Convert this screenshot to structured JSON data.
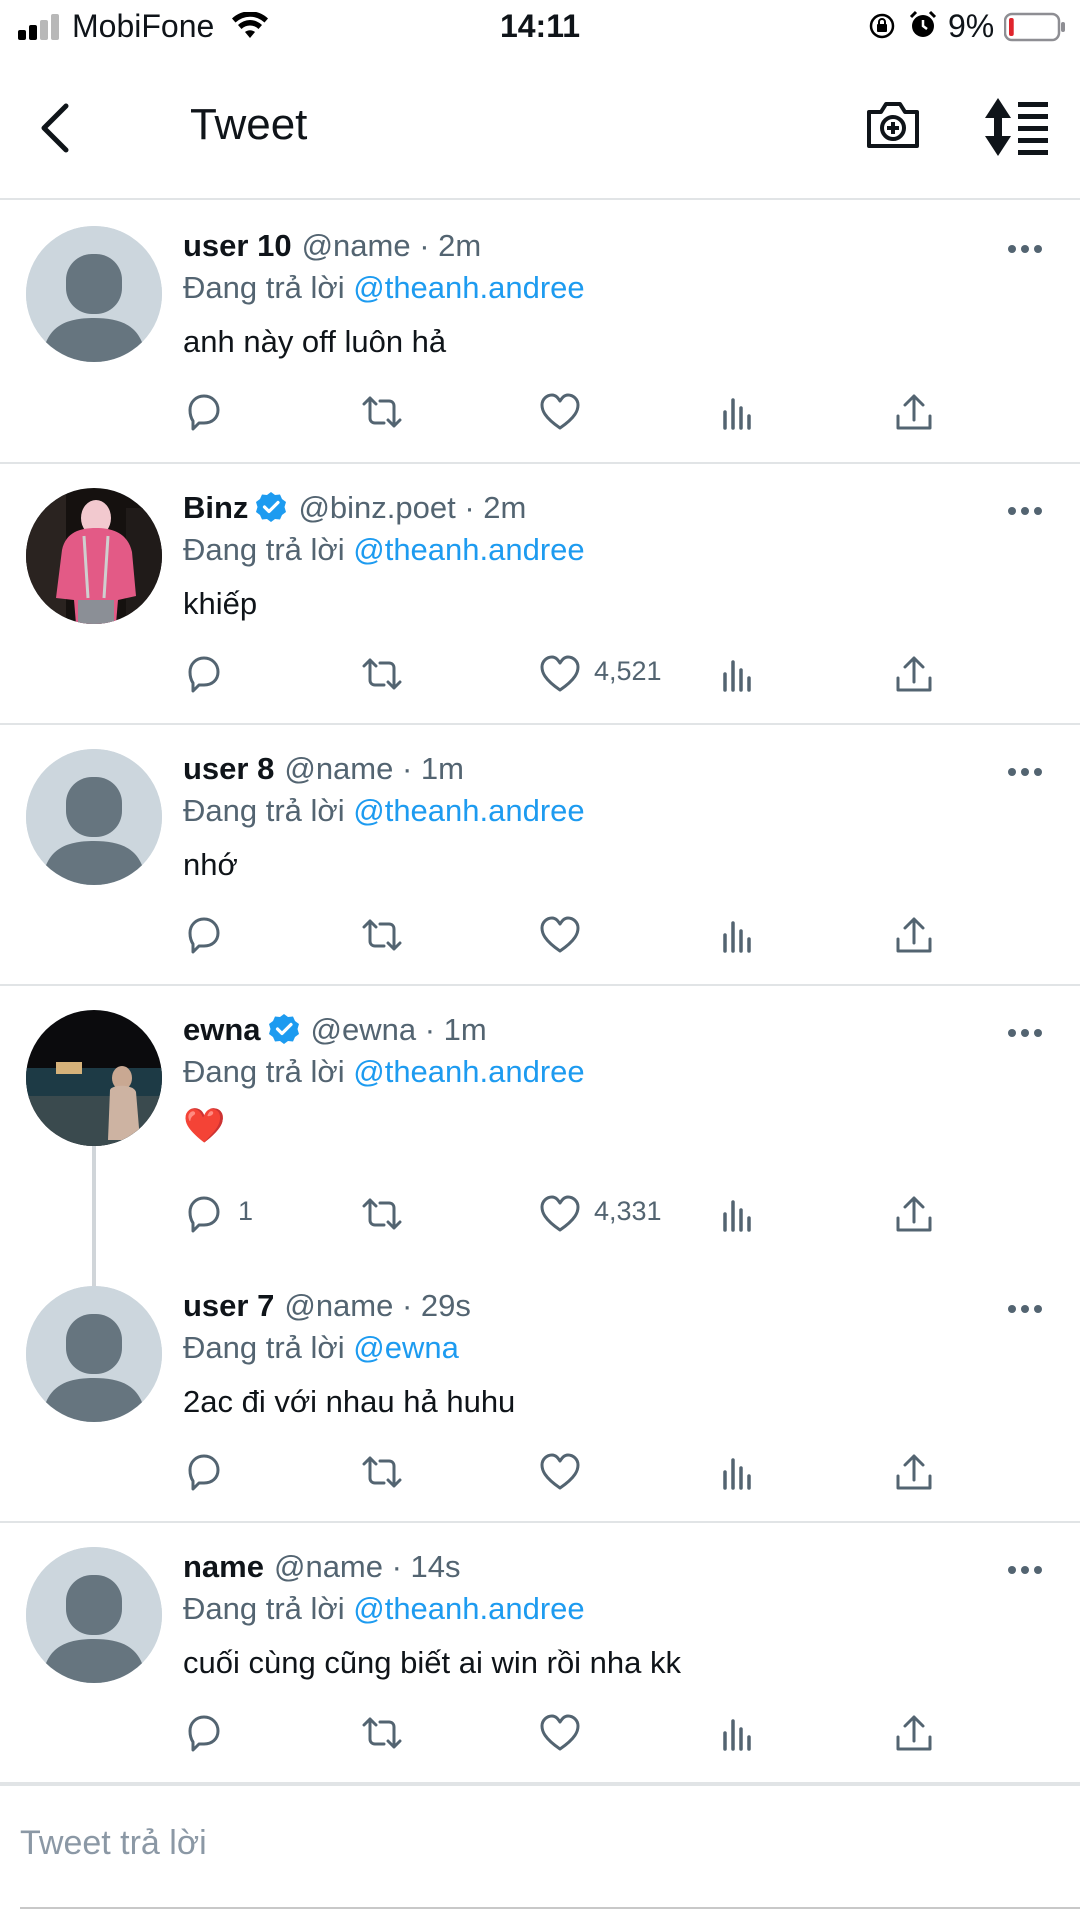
{
  "status_bar": {
    "carrier": "MobiFone",
    "time": "14:11",
    "battery_percent": "9%",
    "battery_level": 0.09,
    "icons": [
      "signal-icon",
      "wifi-icon",
      "orientation-lock-icon",
      "alarm-icon",
      "battery-icon"
    ]
  },
  "header": {
    "title": "Tweet",
    "icons": [
      "back-arrow-icon",
      "camera-plus-icon",
      "sort-icon"
    ]
  },
  "replies": [
    {
      "display_name": "user 10",
      "verified": false,
      "handle": "@name",
      "time": " · 2m",
      "replying_prefix": "Đang trả lời ",
      "replying_to": "@theanh.andree",
      "text": "anh này off luôn hả",
      "reply_count": "",
      "like_count": "",
      "avatar": "default-avatar"
    },
    {
      "display_name": "Binz",
      "verified": true,
      "handle": "@binz.poet",
      "time": " · 2m",
      "replying_prefix": "Đang trả lời ",
      "replying_to": "@theanh.andree",
      "text": "khiếp",
      "reply_count": "",
      "like_count": "4,521",
      "avatar": "photo-pink-hoodie"
    },
    {
      "display_name": "user 8",
      "verified": false,
      "handle": "@name",
      "time": " · 1m",
      "replying_prefix": "Đang trả lời ",
      "replying_to": "@theanh.andree",
      "text": "nhớ",
      "reply_count": "",
      "like_count": "",
      "avatar": "default-avatar"
    },
    {
      "display_name": "ewna",
      "verified": true,
      "handle": "@ewna",
      "time": " · 1m",
      "replying_prefix": "Đang trả lời ",
      "replying_to": "@theanh.andree",
      "text": "❤️",
      "reply_count": "1",
      "like_count": "4,331",
      "avatar": "photo-night-pool"
    },
    {
      "display_name": "user 7",
      "verified": false,
      "handle": "@name",
      "time": " · 29s",
      "replying_prefix": "Đang trả lời ",
      "replying_to": "@ewna",
      "text": "2ac đi với nhau hả huhu",
      "reply_count": "",
      "like_count": "",
      "avatar": "default-avatar"
    },
    {
      "display_name": "name",
      "verified": false,
      "handle": "@name",
      "time": " · 14s",
      "replying_prefix": "Đang trả lời ",
      "replying_to": "@theanh.andree",
      "text": "cuối cùng cũng biết ai win rồi nha kk",
      "reply_count": "",
      "like_count": "",
      "avatar": "default-avatar"
    }
  ],
  "action_icons": [
    "reply-icon",
    "retweet-icon",
    "like-icon",
    "analytics-icon",
    "share-icon"
  ],
  "compose": {
    "placeholder": "Tweet trả lời"
  },
  "colors": {
    "accent": "#1d9bf0",
    "secondary_text": "#536471",
    "icon": "#536471",
    "divider": "#e1e4e6",
    "battery_low": "#e0242c"
  }
}
